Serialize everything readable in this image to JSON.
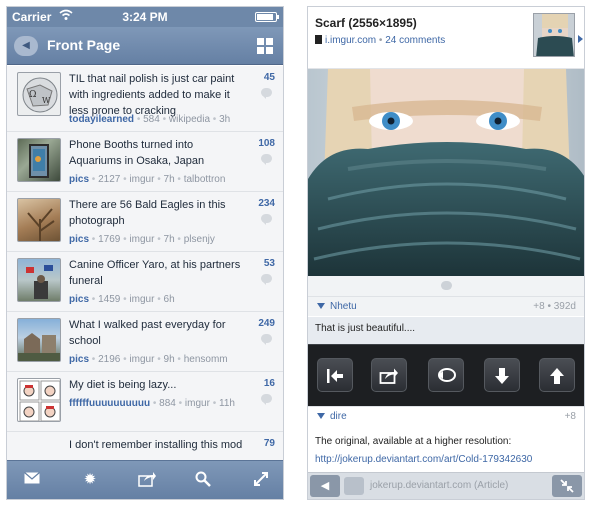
{
  "left": {
    "status": {
      "carrier": "Carrier",
      "time": "3:24 PM",
      "battery_level": 0.9
    },
    "nav": {
      "title": "Front Page"
    },
    "posts": [
      {
        "title": "TIL that nail polish is just car paint with ingredients added to make it less prone to cracking",
        "sub": "todayilearned",
        "score": "584",
        "domain": "wikipedia",
        "age": "3h",
        "author": "",
        "comments": "45",
        "thumb": "wikipedia-globe"
      },
      {
        "title": "Phone Booths turned into Aquariums in Osaka, Japan",
        "sub": "pics",
        "score": "2127",
        "domain": "imgur",
        "age": "7h",
        "author": "talbottron",
        "comments": "108",
        "thumb": "aquarium-booth"
      },
      {
        "title": "There are 56 Bald Eagles in this photograph",
        "sub": "pics",
        "score": "1769",
        "domain": "imgur",
        "age": "7h",
        "author": "plsenjy",
        "comments": "234",
        "thumb": "eagles-tree"
      },
      {
        "title": "Canine Officer Yaro, at his partners funeral",
        "sub": "pics",
        "score": "1459",
        "domain": "imgur",
        "age": "6h",
        "author": "",
        "comments": "53",
        "thumb": "funeral-flags"
      },
      {
        "title": "What I walked past everyday for school",
        "sub": "pics",
        "score": "2196",
        "domain": "imgur",
        "age": "9h",
        "author": "hensomm",
        "comments": "249",
        "thumb": "old-building"
      },
      {
        "title": "My diet is being lazy...",
        "sub": "ffffffuuuuuuuuuu",
        "score": "884",
        "domain": "imgur",
        "age": "11h",
        "author": "",
        "comments": "16",
        "thumb": "rage-comic"
      },
      {
        "title": "I don't remember installing this mod",
        "sub": "",
        "score": "",
        "domain": "",
        "age": "",
        "author": "",
        "comments": "79",
        "thumb": ""
      }
    ],
    "toolbar": [
      "mail-icon",
      "gear-icon",
      "share-icon",
      "search-icon",
      "expand-icon"
    ]
  },
  "right": {
    "post": {
      "title": "Scarf (2556×1895)",
      "domain": "i.imgur.com",
      "separator": "•",
      "comments": "24 comments"
    },
    "comments": [
      {
        "user": "Nhetu",
        "score": "+8 • 392d",
        "text": "That is just beautiful...."
      },
      {
        "user": "dire",
        "score": "+8",
        "text": "The original, available at a higher resolution:",
        "link": "http://jokerup.deviantart.com/art/Cold-179342630"
      }
    ],
    "actions": [
      "first-comment-icon",
      "share-icon",
      "reply-icon",
      "next-comment-icon",
      "previous-comment-icon"
    ],
    "bottom": {
      "link_text": "jokerup.deviantart.com (Article)"
    }
  },
  "colors": {
    "nav": "#6e88a9",
    "link": "#3f68a6",
    "list_bg": "#f4f5f7",
    "action_bar": "#1d1f22"
  }
}
